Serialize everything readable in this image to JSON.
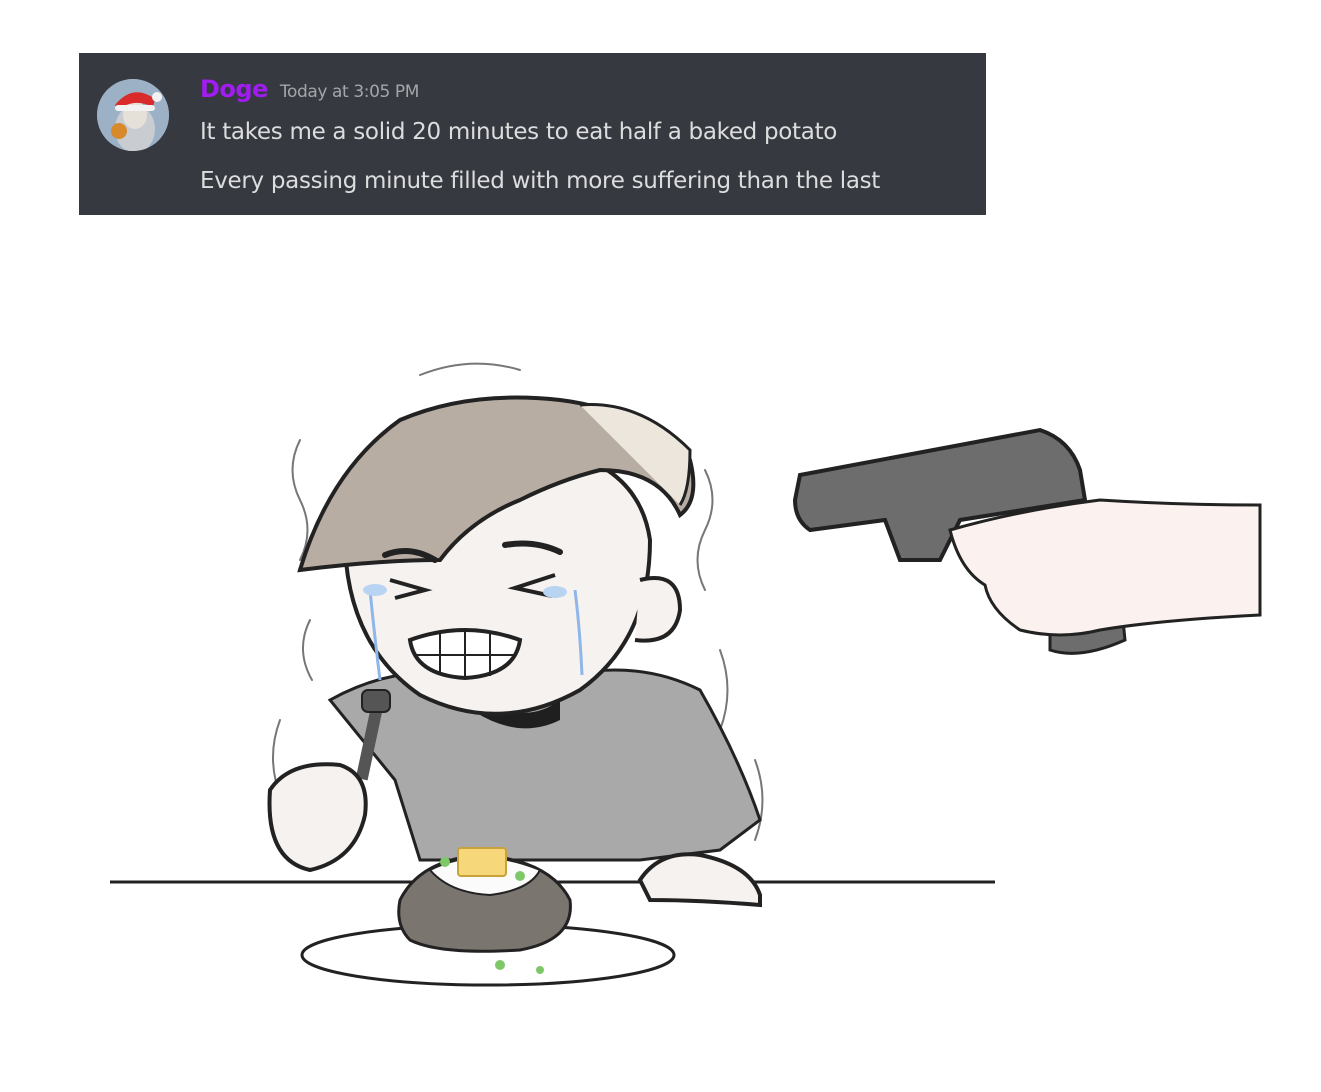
{
  "message": {
    "username": "Doge",
    "timestamp": "Today at 3:05 PM",
    "lines": [
      "It takes me a solid 20 minutes to eat half a baked potato",
      "Every passing minute filled with more suffering than the last"
    ],
    "username_color": "#a01cf0",
    "background_color": "#36393f"
  },
  "illustration": {
    "subject": "crying-man-eating-baked-potato-at-gunpoint"
  }
}
